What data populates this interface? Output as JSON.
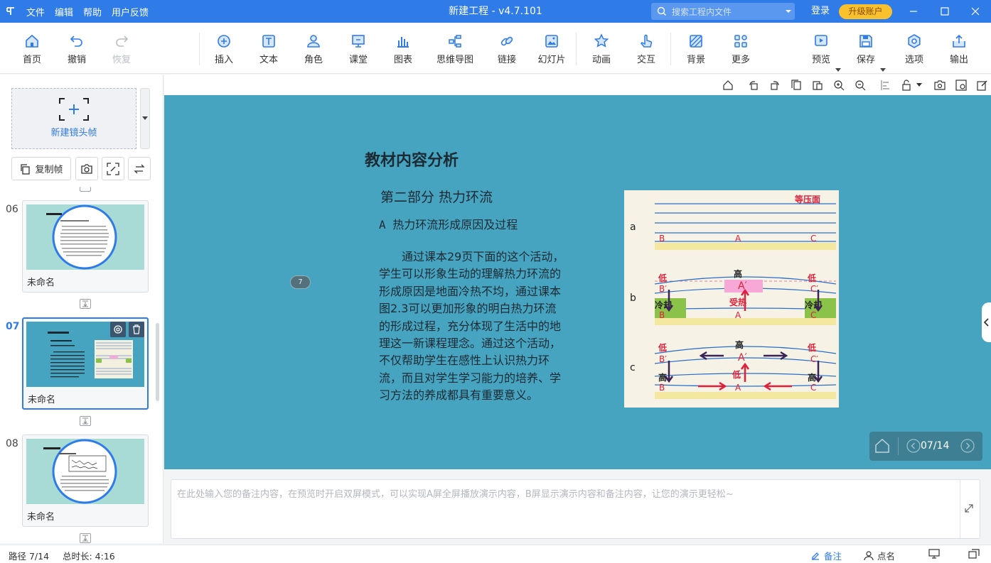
{
  "titlebar": {
    "menu": [
      "文件",
      "编辑",
      "帮助",
      "用户反馈"
    ],
    "title": "新建工程 - v4.7.101",
    "search_placeholder": "搜索工程内文件",
    "login": "登录",
    "upgrade": "升级账户"
  },
  "toolbar": {
    "home": "首页",
    "undo": "撤销",
    "redo": "恢复",
    "insert": "插入",
    "text": "文本",
    "role": "角色",
    "classroom": "课堂",
    "chart": "图表",
    "mindmap": "思维导图",
    "link": "链接",
    "slideshow": "幻灯片",
    "animation": "动画",
    "interact": "交互",
    "background": "背景",
    "more": "更多",
    "preview": "预览",
    "save": "保存",
    "options": "选项",
    "export": "输出"
  },
  "leftpanel": {
    "new_frame": "新建镜头帧",
    "copy_frame": "复制帧",
    "slides": [
      {
        "num": "06",
        "name": "未命名"
      },
      {
        "num": "07",
        "name": "未命名"
      },
      {
        "num": "08",
        "name": "未命名"
      }
    ]
  },
  "slide": {
    "title": "教材内容分析",
    "subtitle": "第二部分  热力环流",
    "section": "A 热力环流形成原因及过程",
    "body": "通过课本29页下面的这个活动，学生可以形象生动的理解热力环流的形成原因是地面冷热不均，通过课本图2.3可以更加形象的明白热力环流的形成过程，充分体现了生活中的地理这一新课程理念。通过这个活动，不仅帮助学生在感性上认识热力环流，而且对学生学习能力的培养、学习方法的养成都具有重要意义。",
    "marker": "7",
    "figure": {
      "top_label": "等压面",
      "rows": [
        {
          "tag": "a",
          "points": [
            "B",
            "A",
            "C"
          ]
        },
        {
          "tag": "b",
          "points": [
            "B′",
            "A′",
            "C′"
          ],
          "low": "低",
          "high": "高",
          "cool": "冷却",
          "heat": "受热",
          "base": [
            "B",
            "A",
            "C"
          ]
        },
        {
          "tag": "c",
          "points": [
            "B′",
            "A′",
            "C′"
          ],
          "low": "低",
          "high": "高",
          "base": [
            "B",
            "A",
            "C"
          ]
        }
      ]
    }
  },
  "nav": {
    "counter": "07/14"
  },
  "notes": {
    "placeholder": "在此处输入您的备注内容，在预览时开启双屏模式，可以实现A屏全屏播放演示内容，B屏显示演示内容和备注内容，让您的演示更轻松~"
  },
  "status": {
    "path": "路径 7/14",
    "duration": "总时长: 4:16",
    "notes": "备注",
    "rollcall": "点名"
  }
}
